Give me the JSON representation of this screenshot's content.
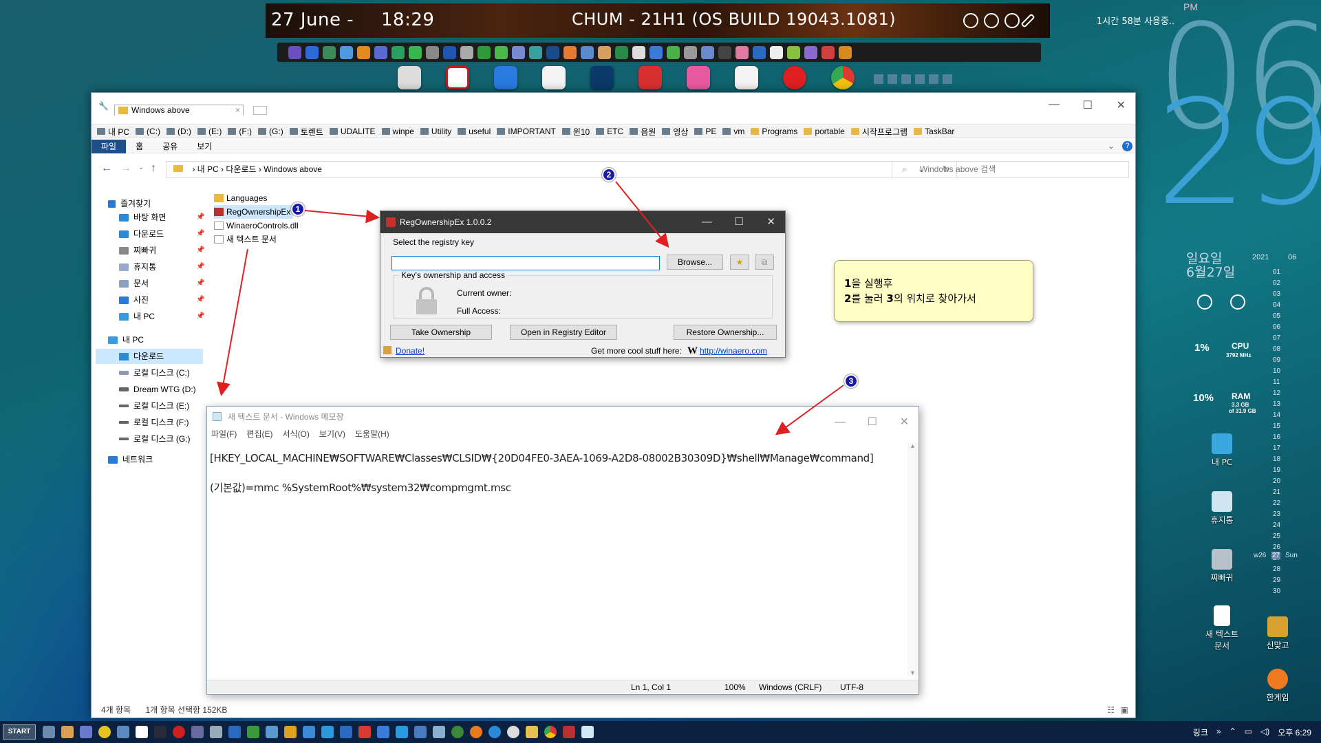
{
  "top": {
    "date": "27 June -",
    "time": "18:29",
    "build": "CHUM - 21H1 (OS BUILD 19043.1081)",
    "uptime": "1시간 58분 사용중..",
    "ampm": "PM"
  },
  "clock": {
    "hour": "06",
    "minute": "29"
  },
  "explorer": {
    "tab_title": "Windows above",
    "favbar": [
      {
        "label": "내 PC",
        "folder": false
      },
      {
        "label": "(C:)",
        "folder": false
      },
      {
        "label": "(D:)",
        "folder": false
      },
      {
        "label": "(E:)",
        "folder": false
      },
      {
        "label": "(F:)",
        "folder": false
      },
      {
        "label": "(G:)",
        "folder": false
      },
      {
        "label": "토렌트",
        "folder": false
      },
      {
        "label": "UDALITE",
        "folder": false
      },
      {
        "label": "winpe",
        "folder": false
      },
      {
        "label": "Utility",
        "folder": false
      },
      {
        "label": "useful",
        "folder": false
      },
      {
        "label": "IMPORTANT",
        "folder": false
      },
      {
        "label": "윈10",
        "folder": false
      },
      {
        "label": "ETC",
        "folder": false
      },
      {
        "label": "음원",
        "folder": false
      },
      {
        "label": "영상",
        "folder": false
      },
      {
        "label": "PE",
        "folder": false
      },
      {
        "label": "vm",
        "folder": false
      },
      {
        "label": "Programs",
        "folder": true
      },
      {
        "label": "portable",
        "folder": true
      },
      {
        "label": "시작프로그램",
        "folder": true
      },
      {
        "label": "TaskBar",
        "folder": true
      }
    ],
    "ribbon": [
      "파일",
      "홈",
      "공유",
      "보기"
    ],
    "breadcrumb": [
      "내 PC",
      "다운로드",
      "Windows above"
    ],
    "search_placeholder": "Windows above 검색",
    "nav": {
      "quick": "즐겨찾기",
      "quick_items": [
        "바탕 화면",
        "다운로드",
        "찌빠귀",
        "휴지통",
        "문서",
        "사진",
        "내 PC"
      ],
      "thispc": "내 PC",
      "pc_items": [
        "다운로드",
        "로컬 디스크 (C:)",
        "Dream WTG (D:)",
        "로컬 디스크 (E:)",
        "로컬 디스크 (F:)",
        "로컬 디스크 (G:)"
      ],
      "network": "네트워크"
    },
    "files": [
      "Languages",
      "RegOwnershipEx",
      "WinaeroControls.dll",
      "새 텍스트 문서"
    ],
    "status_count": "4개 항목",
    "status_selected": "1개 항목 선택함 152KB"
  },
  "reg": {
    "title": "RegOwnershipEx 1.0.0.2",
    "select_label": "Select the registry key",
    "browse": "Browse...",
    "group_label": "Key's ownership and access",
    "current_owner": "Current owner:",
    "full_access": "Full Access:",
    "take": "Take Ownership",
    "open": "Open in Registry Editor",
    "restore": "Restore Ownership...",
    "donate": "Donate!",
    "more": "Get more cool stuff here:",
    "link": "http://winaero.com"
  },
  "notepad": {
    "title": "새 텍스트 문서 - Windows 메모장",
    "menu": [
      "파일(F)",
      "편집(E)",
      "서식(O)",
      "보기(V)",
      "도움말(H)"
    ],
    "line1": "[HKEY_LOCAL_MACHINE₩SOFTWARE₩Classes₩CLSID₩{20D04FE0-3AEA-1069-A2D8-08002B30309D}₩shell₩Manage₩command]",
    "line2": "(기본값)=mmc %SystemRoot%₩system32₩compmgmt.msc",
    "pos": "Ln 1, Col 1",
    "zoom": "100%",
    "eol": "Windows (CRLF)",
    "enc": "UTF-8"
  },
  "sticky": {
    "n1": "1",
    "line1_rest": "을 실행후",
    "n2": "2",
    "line2_mid": "를 눌러 ",
    "n3": "3",
    "line2_rest": "의 위치로 찾아가서"
  },
  "callouts": [
    "1",
    "2",
    "3"
  ],
  "side": {
    "day": "일요일",
    "date": "6월27일",
    "year": "2021",
    "month": "06",
    "week": "w26",
    "today": "27",
    "todayname": "Sun",
    "cpu_pct": "1%",
    "cpu": "CPU",
    "cpu_mhz": "3792 MHz",
    "ram_pct": "10%",
    "ram": "RAM",
    "ram_used": "3.3 GB",
    "ram_total": "of 31.9 GB",
    "days": [
      "01",
      "02",
      "03",
      "04",
      "05",
      "06",
      "07",
      "08",
      "09",
      "10",
      "11",
      "12",
      "13",
      "14",
      "15",
      "16",
      "17",
      "18",
      "19",
      "20",
      "21",
      "22",
      "23",
      "24",
      "25",
      "26",
      "27",
      "28",
      "29",
      "30"
    ]
  },
  "desktop": {
    "mypc": "내 PC",
    "recycle": "휴지통",
    "jjip": "찌빠귀",
    "newtxt": "새 텍스트\n문서",
    "sinmatgo": "신맞고",
    "hangame": "한게임"
  },
  "taskbar": {
    "start": "START",
    "link": "링크",
    "time": "오후 6:29"
  }
}
